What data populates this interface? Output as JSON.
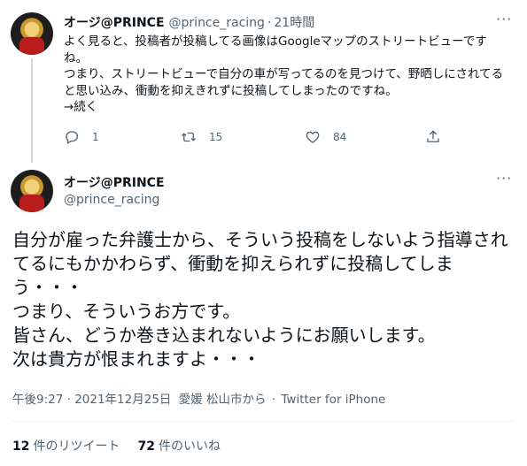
{
  "reply_tweet": {
    "display_name": "オージ@PRINCE",
    "handle": "@prince_racing",
    "separator": "·",
    "time": "21時間",
    "text": "よく見ると、投稿者が投稿してる画像はGoogleマップのストリートビューですね。\nつまり、ストリートビューで自分の車が写ってるのを見つけて、野晒しにされてると思い込み、衝動を抑えきれずに投稿してしまったのですね。\n→続く",
    "reply_count": "1",
    "retweet_count": "15",
    "like_count": "84"
  },
  "main_tweet": {
    "display_name": "オージ@PRINCE",
    "handle": "@prince_racing",
    "text": "自分が雇った弁護士から、そういう投稿をしないよう指導されてるにもかかわらず、衝動を抑えられずに投稿してしまう・・・\nつまり、そういうお方です。\n皆さん、どうか巻き込まれないようにお願いします。\n次は貴方が恨まれますよ・・・",
    "timestamp": "午後9:27 · 2021年12月25日",
    "location": "愛媛 松山市から",
    "source_sep": "·",
    "source": "Twitter for iPhone",
    "retweets_count": "12",
    "retweets_label": "件のリツイート",
    "likes_count": "72",
    "likes_label": "件のいいね"
  },
  "more_glyph": "···"
}
